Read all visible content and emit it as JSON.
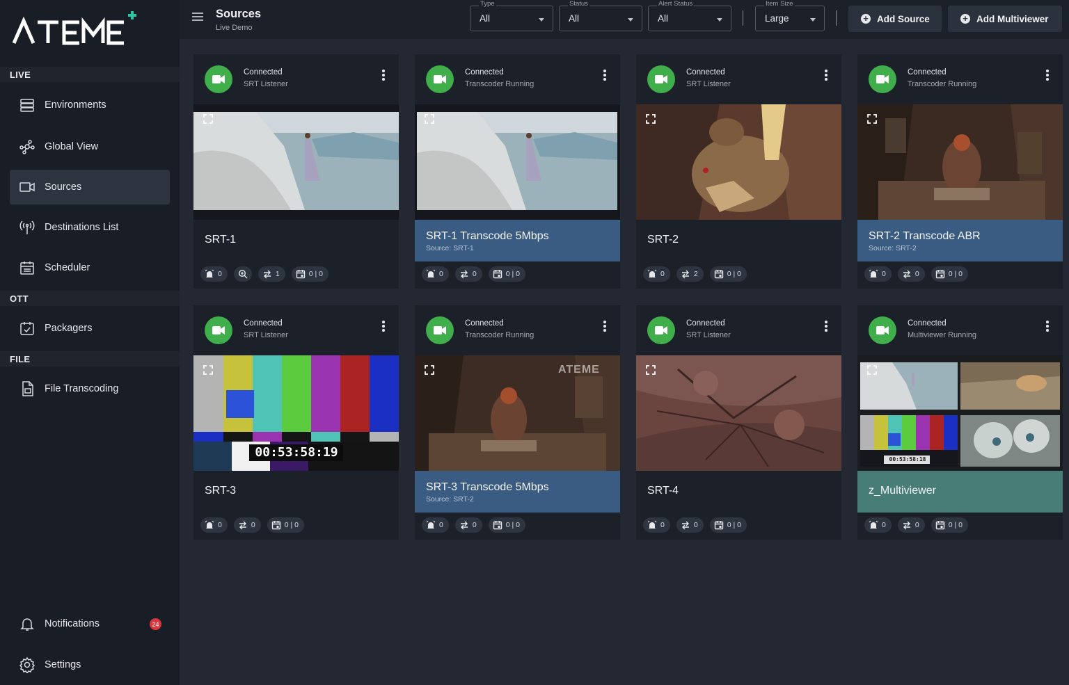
{
  "brand": {
    "logo_text": "ATEME"
  },
  "sidebar": {
    "sections": {
      "live": "LIVE",
      "ott": "OTT",
      "file": "FILE"
    },
    "items": {
      "environments": "Environments",
      "global_view": "Global View",
      "sources": "Sources",
      "destinations": "Destinations List",
      "scheduler": "Scheduler",
      "packagers": "Packagers",
      "file_transcoding": "File Transcoding",
      "notifications": "Notifications",
      "settings": "Settings"
    },
    "notifications_count": "24"
  },
  "header": {
    "title": "Sources",
    "subtitle": "Live Demo",
    "filters": {
      "type": {
        "label": "Type",
        "value": "All"
      },
      "status": {
        "label": "Status",
        "value": "All"
      },
      "alert_status": {
        "label": "Alert Status",
        "value": "All"
      },
      "item_size": {
        "label": "Item Size",
        "value": "Large"
      }
    },
    "add_source": "Add Source",
    "add_multiviewer": "Add Multiviewer"
  },
  "colors": {
    "accent_green": "#3fae4b",
    "transcode_blue": "#3a5b82",
    "multiviewer_teal": "#477d76",
    "badge_red": "#d9363e"
  },
  "cards": [
    {
      "status": "Connected",
      "type": "SRT Listener",
      "name": "SRT-1",
      "source": "",
      "alerts": "0",
      "extra": "1",
      "sched": "0 | 0"
    },
    {
      "status": "Connected",
      "type": "Transcoder Running",
      "name": "SRT-1 Transcode 5Mbps",
      "source": "Source: SRT-1",
      "alerts": "0",
      "routes": "0",
      "sched": "0 | 0"
    },
    {
      "status": "Connected",
      "type": "SRT Listener",
      "name": "SRT-2",
      "source": "",
      "alerts": "0",
      "routes": "2",
      "sched": "0 | 0"
    },
    {
      "status": "Connected",
      "type": "Transcoder Running",
      "name": "SRT-2 Transcode ABR",
      "source": "Source: SRT-2",
      "alerts": "0",
      "routes": "0",
      "sched": "0 | 0"
    },
    {
      "status": "Connected",
      "type": "SRT Listener",
      "name": "SRT-3",
      "source": "",
      "alerts": "0",
      "routes": "0",
      "sched": "0 | 0",
      "timecode": "00:53:58:19"
    },
    {
      "status": "Connected",
      "type": "Transcoder Running",
      "name": "SRT-3 Transcode 5Mbps",
      "source": "Source: SRT-2",
      "alerts": "0",
      "routes": "0",
      "sched": "0 | 0",
      "watermark": "ATEME"
    },
    {
      "status": "Connected",
      "type": "SRT Listener",
      "name": "SRT-4",
      "source": "",
      "alerts": "0",
      "routes": "0",
      "sched": "0 | 0"
    },
    {
      "status": "Connected",
      "type": "Multiviewer Running",
      "name": "z_Multiviewer",
      "source": "",
      "alerts": "0",
      "routes": "0",
      "sched": "0 | 0",
      "timecode": "00:53:58:18"
    }
  ],
  "icons": [
    "hamburger-icon",
    "server-icon",
    "network-icon",
    "camera-outline-icon",
    "antenna-icon",
    "calendar-icon",
    "package-icon",
    "file-icon",
    "bell-icon",
    "gear-icon",
    "video-camera-icon",
    "kebab-icon",
    "expand-icon",
    "alarm-icon",
    "search-zoom-icon",
    "route-arrows-icon",
    "schedule-icon",
    "plus-circle-icon"
  ]
}
